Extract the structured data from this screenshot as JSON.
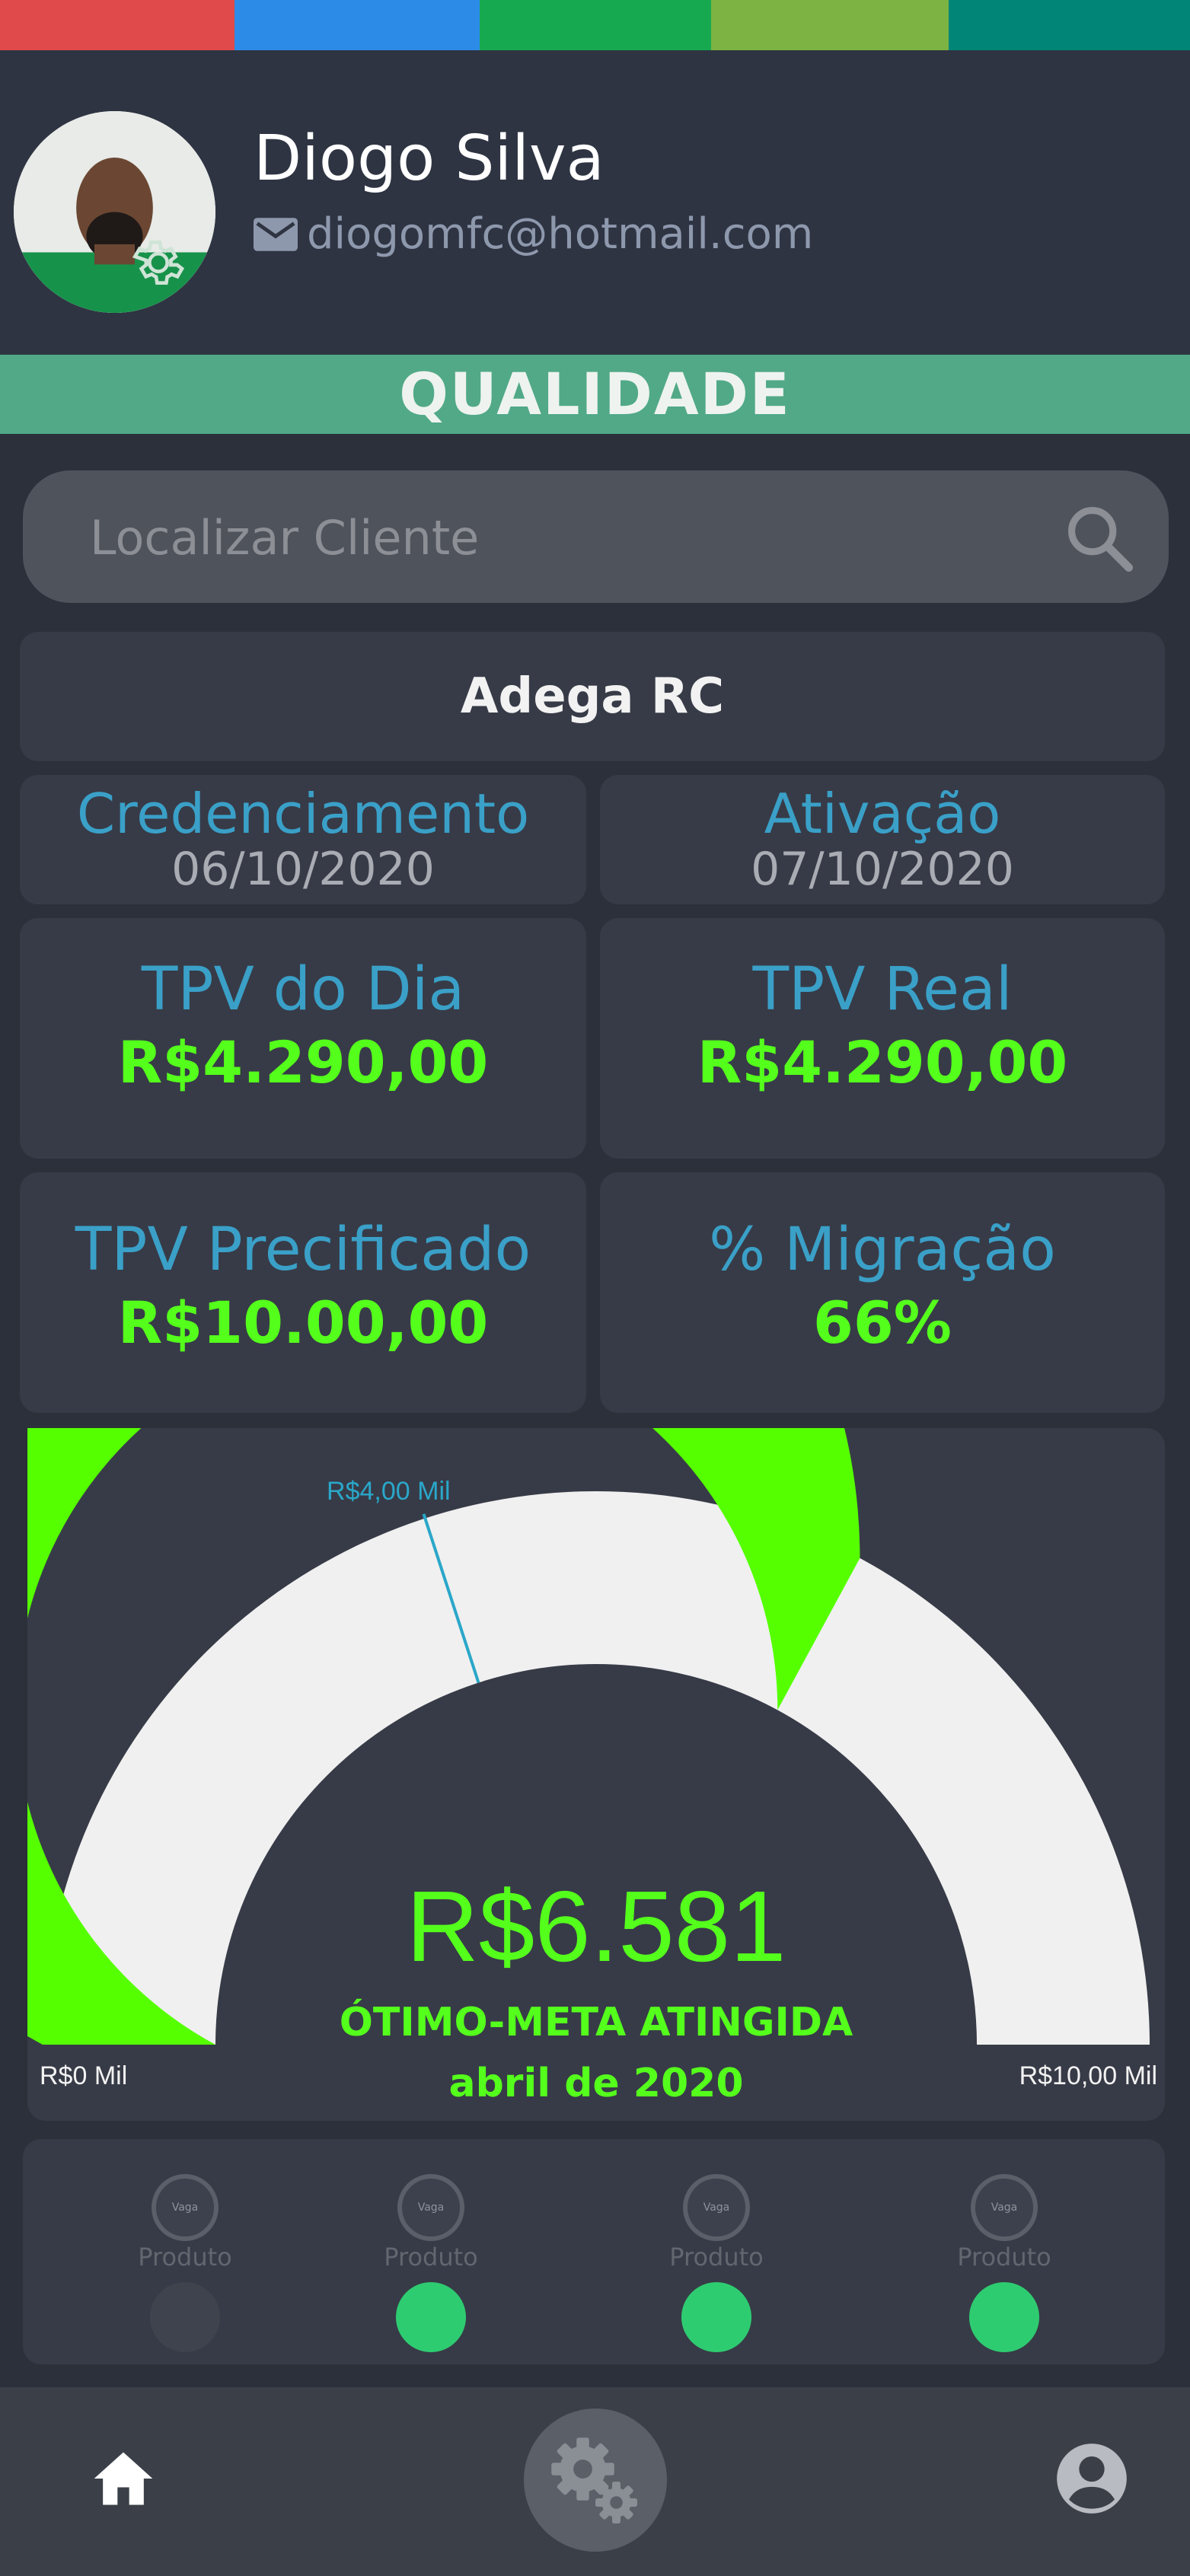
{
  "top_stripes": [
    "#e04a4a",
    "#2d8be8",
    "#17a94f",
    "#7cb342",
    "#008577"
  ],
  "user": {
    "name": "Diogo Silva",
    "email": "diogomfc@hotmail.com"
  },
  "section_banner": "QUALIDADE",
  "search": {
    "placeholder": "Localizar Cliente"
  },
  "client_name": "Adega RC",
  "dates": {
    "credenciamento_label": "Credenciamento",
    "credenciamento_value": "06/10/2020",
    "ativacao_label": "Ativação",
    "ativacao_value": "07/10/2020"
  },
  "tpv": {
    "dia_label": "TPV do Dia",
    "dia_value": "R$4.290,00",
    "real_label": "TPV Real",
    "real_value": "R$4.290,00",
    "precificado_label": "TPV Precificado",
    "precificado_value": "R$10.00,00",
    "migracao_label": "% Migração",
    "migracao_value": "66%"
  },
  "gauge": {
    "min_label": "R$0 Mil",
    "max_label": "R$10,00 Mil",
    "target_label": "R$4,00 Mil",
    "value_text": "R$6.581",
    "status_text": "ÓTIMO-META ATINGIDA",
    "period_text": "abril de 2020",
    "min": 0,
    "max": 10,
    "target": 4,
    "value": 6.581,
    "fill_color": "#55ff00",
    "rest_color": "#f0f0f0",
    "target_line_color": "#2aa7c9"
  },
  "products": [
    {
      "label": "Produto",
      "logo_text": "Vaga",
      "status_color": "#3f434d"
    },
    {
      "label": "Produto",
      "logo_text": "Vaga",
      "status_color": "#2ecc71"
    },
    {
      "label": "Produto",
      "logo_text": "Vaga",
      "status_color": "#2ecc71"
    },
    {
      "label": "Produto",
      "logo_text": "Vaga",
      "status_color": "#2ecc71"
    }
  ],
  "nav": {
    "home_icon": "home-icon",
    "settings_icon": "gears-icon",
    "profile_icon": "account-icon"
  }
}
